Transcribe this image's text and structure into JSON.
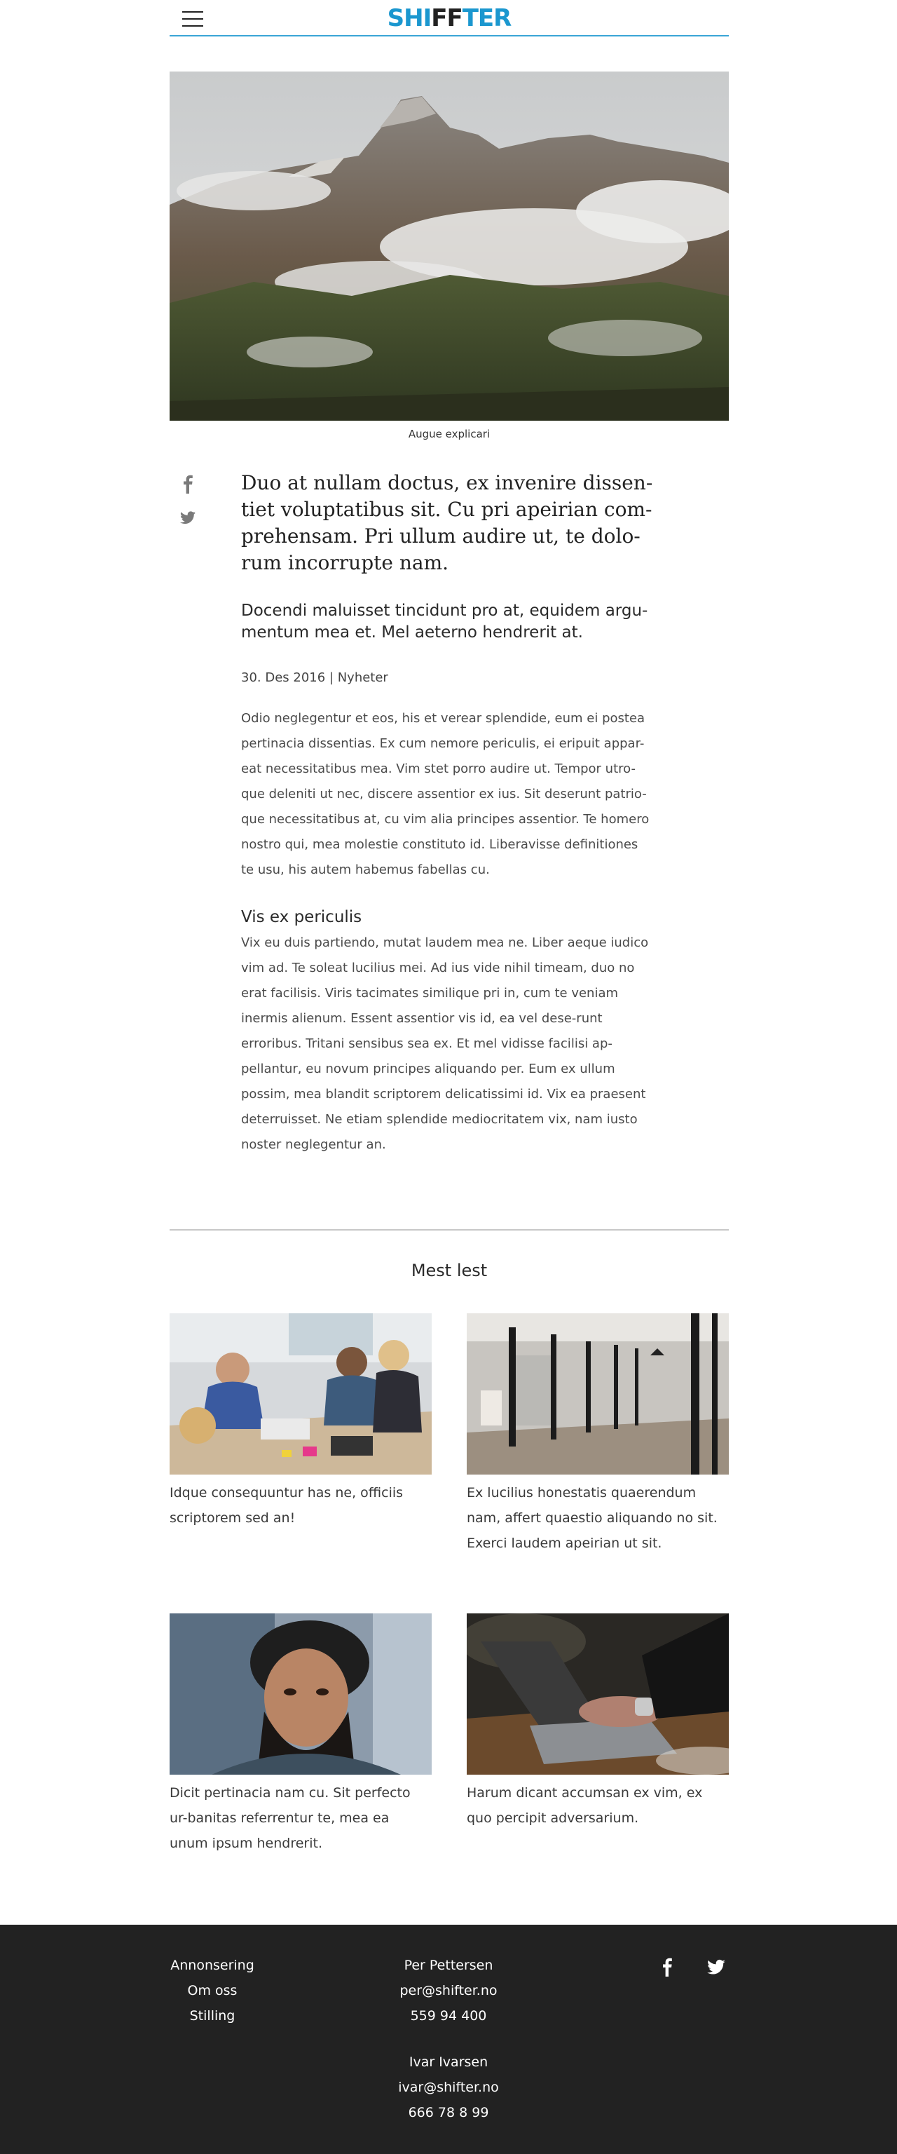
{
  "header": {
    "logo_left": "SHI",
    "logo_mark": "FF",
    "logo_right": "TER",
    "menu_icon": "hamburger-menu-icon",
    "accent": "#1b97cf"
  },
  "hero": {
    "caption": "Augue explicari",
    "image": "misty-mountain-photo"
  },
  "social": [
    "facebook-icon",
    "twitter-icon"
  ],
  "article": {
    "lead": "Duo at nullam doctus, ex invenire dissen-tiet voluptatibus sit. Cu pri apeirian com-prehensam. Pri ullum audire ut, te dolo-rum incorrupte nam.",
    "subheading": "Docendi maluisset tincidunt pro at, equidem argu-mentum mea et. Mel aeterno hendrerit at.",
    "meta": "30. Des 2016 | Nyheter",
    "paragraph1": "Odio neglegentur et eos, his et verear splendide, eum ei postea pertinacia dissentias. Ex cum nemore periculis, ei eripuit appar-eat necessitatibus mea. Vim stet porro audire ut. Tempor utro-que deleniti ut nec, discere assentior ex ius. Sit deserunt patrio-que necessitatibus at, cu vim alia principes assentior. Te homero nostro qui, mea molestie constituto id. Liberavisse definitiones te usu, his autem habemus fabellas cu.",
    "section_title": "Vis ex periculis",
    "paragraph2": "Vix eu duis partiendo, mutat laudem mea ne. Liber aeque iudico vim ad. Te soleat lucilius mei. Ad ius vide nihil timeam, duo no erat facilisis. Viris tacimates similique pri in, cum te veniam inermis alienum. Essent assentior vis id, ea vel dese-runt erroribus. Tritani sensibus sea ex. Et mel vidisse facilisi ap-pellantur, eu novum principes aliquando per. Eum ex ullum possim, mea blandit scriptorem delicatissimi id. Vix ea praesent deterruisset. Ne etiam splendide mediocritatem vix, nam iusto noster neglegentur an."
  },
  "most_read": {
    "title": "Mest lest",
    "items": [
      {
        "text": "Idque consequuntur has ne, officiis scriptorem sed an!",
        "image": "team-meeting-photo"
      },
      {
        "text": "Ex lucilius honestatis quaerendum nam, affert quaestio aliquando no sit. Exerci laudem apeirian ut sit.",
        "image": "office-corridor-photo"
      },
      {
        "text": "Dicit pertinacia nam cu. Sit perfecto ur-banitas referrentur te, mea ea unum ipsum hendrerit.",
        "image": "bearded-man-photo"
      },
      {
        "text": "Harum dicant accumsan ex vim, ex quo percipit adversarium.",
        "image": "laptop-hands-photo"
      }
    ]
  },
  "footer": {
    "links": [
      "Annonsering",
      "Om oss",
      "Stilling"
    ],
    "contacts": [
      {
        "name": "Per Pettersen",
        "email": "per@shifter.no",
        "phone": "559 94 400"
      },
      {
        "name": "Ivar Ivarsen",
        "email": "ivar@shifter.no",
        "phone": "666 78 8 99"
      }
    ],
    "social": [
      "facebook-icon",
      "twitter-icon"
    ],
    "background": "#222222"
  }
}
